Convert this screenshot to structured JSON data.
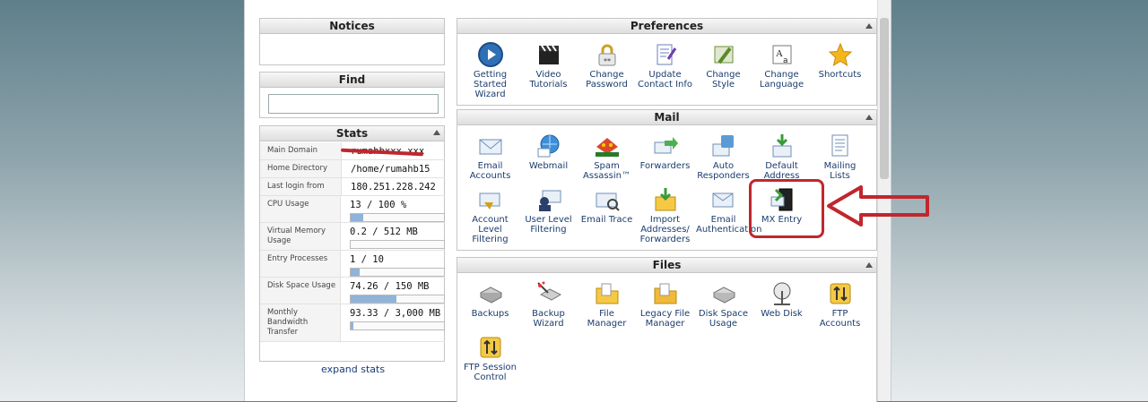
{
  "left": {
    "notices_title": "Notices",
    "find_title": "Find",
    "find_placeholder": "",
    "stats_title": "Stats",
    "stats": [
      {
        "label": "Main Domain",
        "value": "rumahbxxx.xxx",
        "bar": null
      },
      {
        "label": "Home Directory",
        "value": "/home/rumahb15",
        "bar": null
      },
      {
        "label": "Last login from",
        "value": "180.251.228.242",
        "bar": null
      },
      {
        "label": "CPU Usage",
        "value": "13 / 100 %",
        "bar": 0.13
      },
      {
        "label": "Virtual Memory Usage",
        "value": "0.2 / 512 MB",
        "bar": 0.0004
      },
      {
        "label": "Entry Processes",
        "value": "1 / 10",
        "bar": 0.1
      },
      {
        "label": "Disk Space Usage",
        "value": "74.26 / 150 MB",
        "bar": 0.495
      },
      {
        "label": "Monthly Bandwidth Transfer",
        "value": "93.33 / 3,000 MB",
        "bar": 0.031
      }
    ],
    "expand_label": "expand stats"
  },
  "preferences": {
    "title": "Preferences",
    "items": [
      {
        "label": "Getting Started Wizard",
        "icon": "play-icon"
      },
      {
        "label": "Video Tutorials",
        "icon": "clapper-icon"
      },
      {
        "label": "Change Password",
        "icon": "password-icon"
      },
      {
        "label": "Update Contact Info",
        "icon": "contact-icon"
      },
      {
        "label": "Change Style",
        "icon": "style-icon"
      },
      {
        "label": "Change Language",
        "icon": "language-icon"
      },
      {
        "label": "Shortcuts",
        "icon": "star-icon"
      }
    ]
  },
  "mail": {
    "title": "Mail",
    "items": [
      {
        "label": "Email Accounts",
        "icon": "envelope-icon"
      },
      {
        "label": "Webmail",
        "icon": "globe-mail-icon"
      },
      {
        "label": "Spam Assassin™",
        "icon": "spamassassin-icon"
      },
      {
        "label": "Forwarders",
        "icon": "forward-icon"
      },
      {
        "label": "Auto Responders",
        "icon": "autoresponder-icon"
      },
      {
        "label": "Default Address",
        "icon": "default-address-icon"
      },
      {
        "label": "Mailing Lists",
        "icon": "mailing-list-icon"
      },
      {
        "label": "Account Level Filtering",
        "icon": "filter-icon"
      },
      {
        "label": "User Level Filtering",
        "icon": "user-filter-icon"
      },
      {
        "label": "Email Trace",
        "icon": "trace-icon"
      },
      {
        "label": "Import Addresses/ Forwarders",
        "icon": "import-icon"
      },
      {
        "label": "Email Authentication",
        "icon": "auth-icon"
      },
      {
        "label": "MX Entry",
        "icon": "mx-icon"
      }
    ]
  },
  "files": {
    "title": "Files",
    "items": [
      {
        "label": "Backups",
        "icon": "backup-icon"
      },
      {
        "label": "Backup Wizard",
        "icon": "backup-wizard-icon"
      },
      {
        "label": "File Manager",
        "icon": "folder-icon"
      },
      {
        "label": "Legacy File Manager",
        "icon": "legacy-folder-icon"
      },
      {
        "label": "Disk Space Usage",
        "icon": "disk-icon"
      },
      {
        "label": "Web Disk",
        "icon": "webdisk-icon"
      },
      {
        "label": "FTP Accounts",
        "icon": "ftp-icon"
      },
      {
        "label": "FTP Session Control",
        "icon": "ftp-session-icon"
      }
    ]
  },
  "colors": {
    "annotation": "#c0272d",
    "link": "#1b3c6e"
  }
}
